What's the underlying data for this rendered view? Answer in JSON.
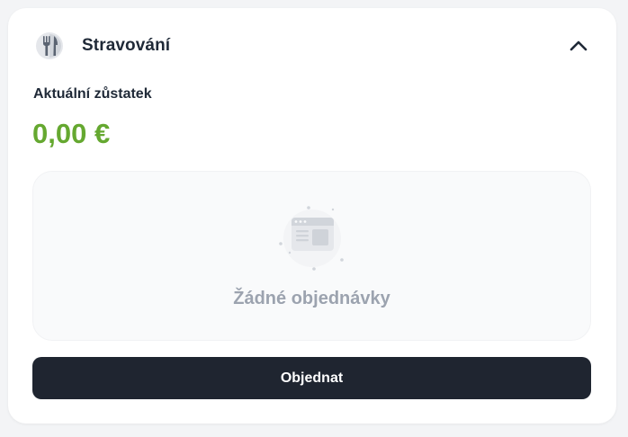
{
  "section": {
    "title": "Stravování",
    "icon": "fork-knife-icon",
    "toggle_icon": "chevron-up-icon"
  },
  "balance": {
    "label": "Aktuální zůstatek",
    "value": "0,00 €",
    "color": "#65a830"
  },
  "orders": {
    "empty_icon": "empty-orders-illustration",
    "empty_text": "Žádné objednávky"
  },
  "actions": {
    "order_label": "Objednat"
  },
  "colors": {
    "primary_button": "#1f2530",
    "muted_text": "#9ca3af"
  }
}
